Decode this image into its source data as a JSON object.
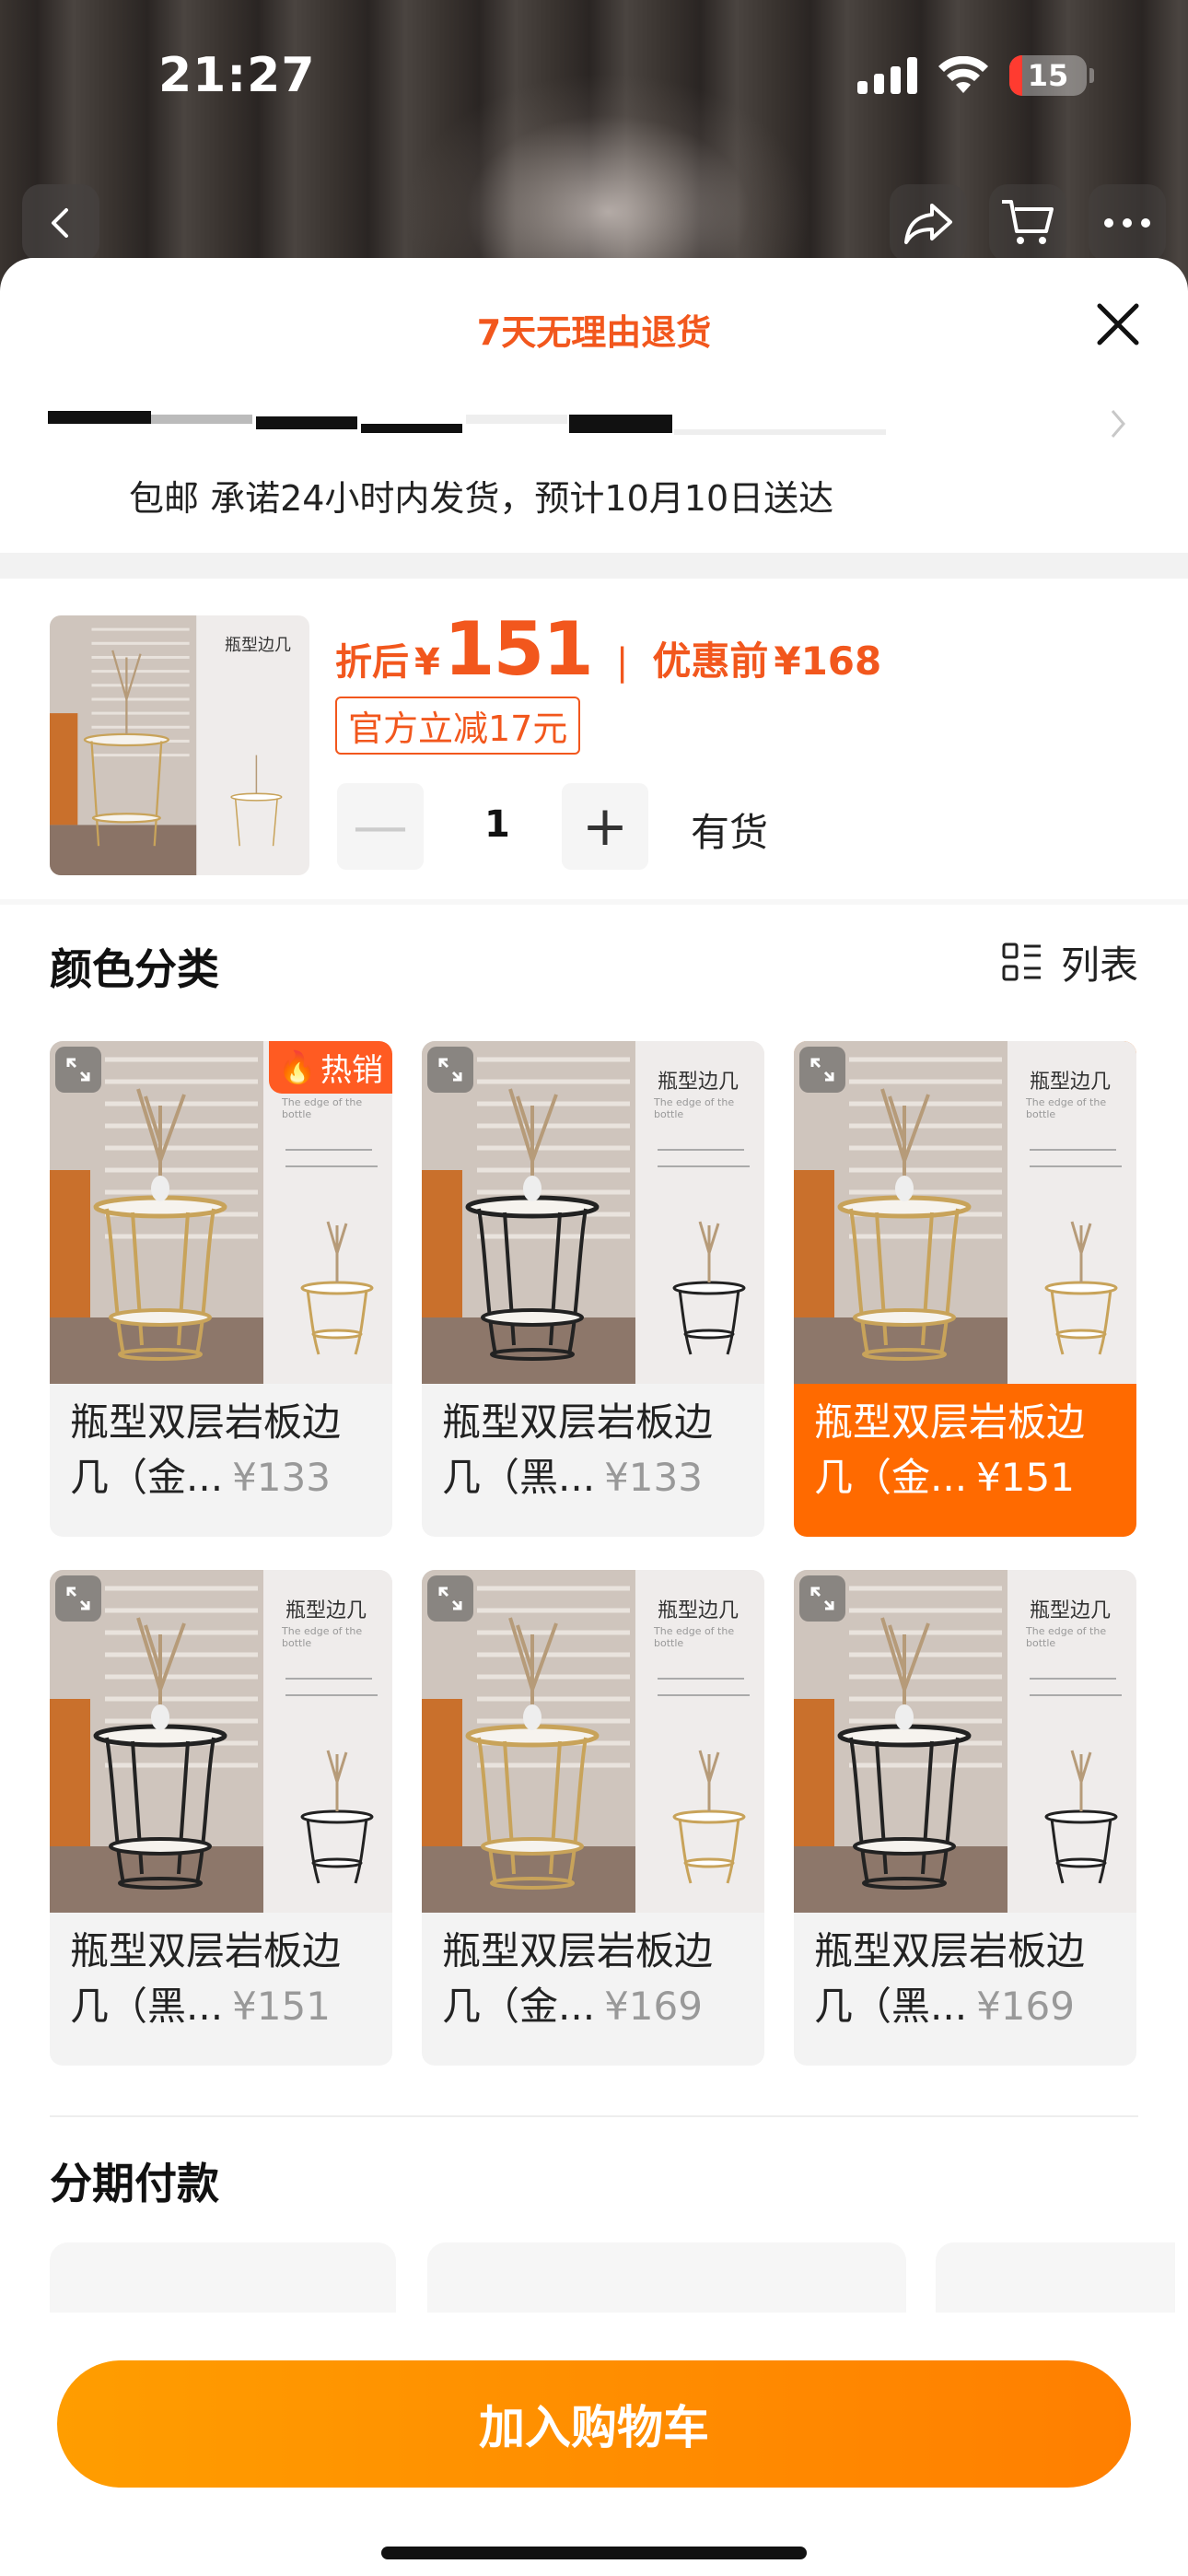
{
  "status_bar": {
    "time": "21:27",
    "battery": "15"
  },
  "sheet": {
    "title": "7天无理由退货",
    "shipping_text": "包邮 承诺24小时内发货，预计10月10日送达"
  },
  "product": {
    "price_label": "折后",
    "currency": "¥",
    "price": "151",
    "price_before_label": "优惠前",
    "price_before": "¥168",
    "discount_tag": "官方立减17元",
    "quantity": "1",
    "minus": "—",
    "plus": "+",
    "stock": "有货",
    "thumb_title": "瓶型边几"
  },
  "color_section": {
    "title": "颜色分类",
    "view_toggle": "列表",
    "hot_badge": "热销",
    "image_label": "瓶型边几",
    "image_sub": "The edge of the bottle",
    "options": [
      {
        "line1": "瓶型双层岩板边",
        "line2": "几（金...",
        "price": "¥133",
        "frame": "#c8a35a",
        "hot": true,
        "selected": false
      },
      {
        "line1": "瓶型双层岩板边",
        "line2": "几（黑...",
        "price": "¥133",
        "frame": "#222222",
        "hot": false,
        "selected": false
      },
      {
        "line1": "瓶型双层岩板边",
        "line2": "几（金...",
        "price": "¥151",
        "frame": "#c8a35a",
        "hot": false,
        "selected": true
      },
      {
        "line1": "瓶型双层岩板边",
        "line2": "几（黑...",
        "price": "¥151",
        "frame": "#222222",
        "hot": false,
        "selected": false
      },
      {
        "line1": "瓶型双层岩板边",
        "line2": "几（金...",
        "price": "¥169",
        "frame": "#c8a35a",
        "hot": false,
        "selected": false
      },
      {
        "line1": "瓶型双层岩板边",
        "line2": "几（黑...",
        "price": "¥169",
        "frame": "#222222",
        "hot": false,
        "selected": false
      }
    ]
  },
  "installment": {
    "title": "分期付款"
  },
  "cta": {
    "add_to_cart": "加入购物车"
  },
  "colors": {
    "accent": "#f2571d",
    "selected": "#ff6a00",
    "cta": "#ff8c00"
  }
}
